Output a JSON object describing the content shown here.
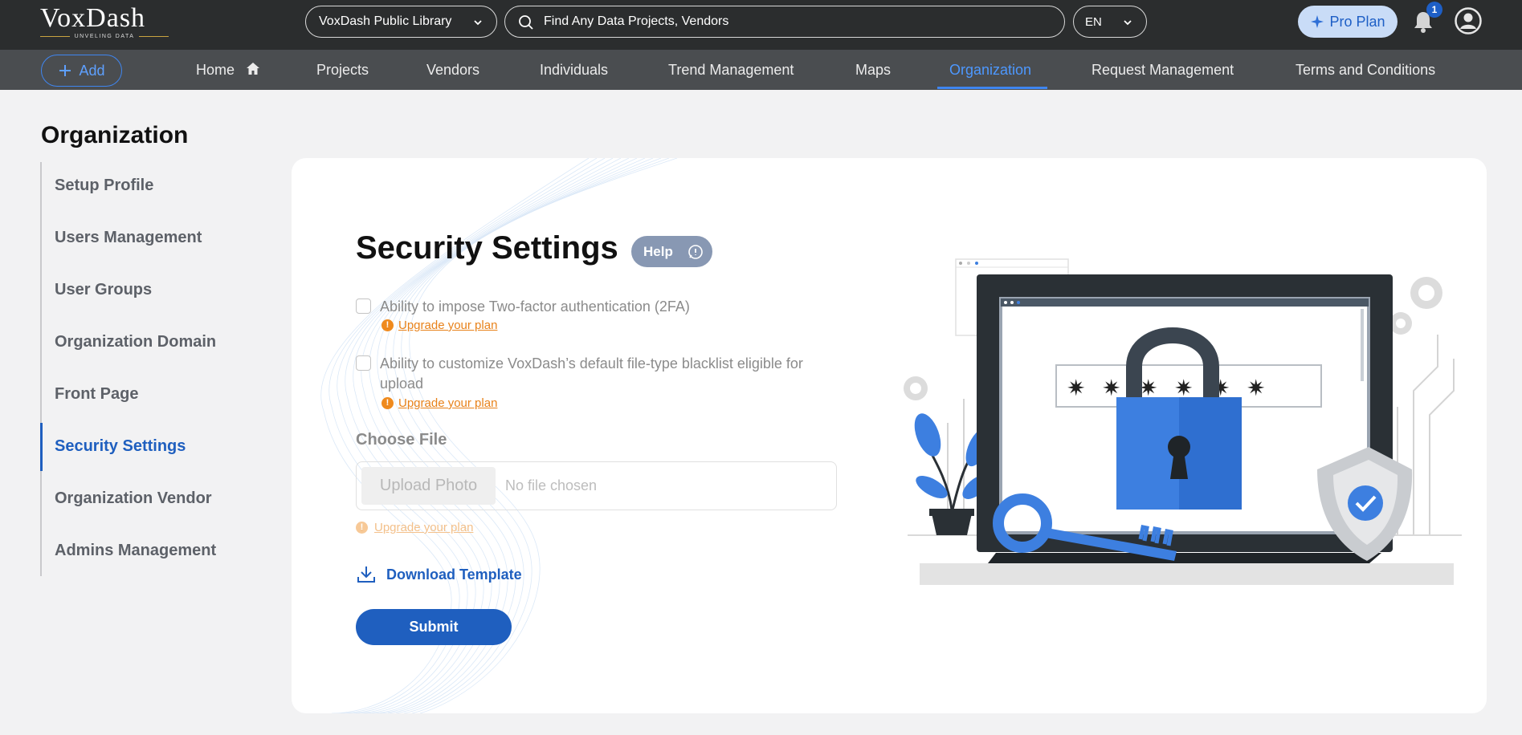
{
  "app": {
    "logo_text": "VoxDash",
    "logo_tagline": "UNVELING DATA",
    "library_select": "VoxDash Public Library",
    "search_placeholder": "Find Any Data Projects, Vendors",
    "language": "EN",
    "pro_plan_label": "Pro Plan",
    "notification_count": "1"
  },
  "nav": {
    "add_label": "Add",
    "items": [
      {
        "label": "Home"
      },
      {
        "label": "Projects"
      },
      {
        "label": "Vendors"
      },
      {
        "label": "Individuals"
      },
      {
        "label": "Trend Management"
      },
      {
        "label": "Maps"
      },
      {
        "label": "Organization"
      },
      {
        "label": "Request Management"
      },
      {
        "label": "Terms and Conditions"
      }
    ],
    "active": "Organization"
  },
  "sidebar": {
    "title": "Organization",
    "items": [
      {
        "label": "Setup Profile"
      },
      {
        "label": "Users Management"
      },
      {
        "label": "User Groups"
      },
      {
        "label": "Organization Domain"
      },
      {
        "label": "Front Page"
      },
      {
        "label": "Security Settings"
      },
      {
        "label": "Organization Vendor"
      },
      {
        "label": "Admins Management"
      }
    ],
    "active": "Security Settings"
  },
  "main": {
    "title": "Security Settings",
    "help_label": "Help",
    "options": [
      {
        "label": "Ability to impose Two-factor authentication (2FA)",
        "checked": false,
        "upgrade_label": "Upgrade your plan"
      },
      {
        "label": "Ability to customize VoxDash’s default file-type blacklist eligible for upload",
        "checked": false,
        "upgrade_label": "Upgrade your plan"
      }
    ],
    "choose_file_label": "Choose File",
    "upload_button": "Upload Photo",
    "no_file_text": "No file chosen",
    "file_upgrade_label": "Upgrade your plan",
    "download_label": "Download Template",
    "submit_label": "Submit"
  },
  "colors": {
    "accent": "#1f5fbf",
    "topbar": "#2b2d2e",
    "navbar": "#4a4d50",
    "warning": "#ef8a1d",
    "illustration_blue": "#3d7fe0"
  }
}
